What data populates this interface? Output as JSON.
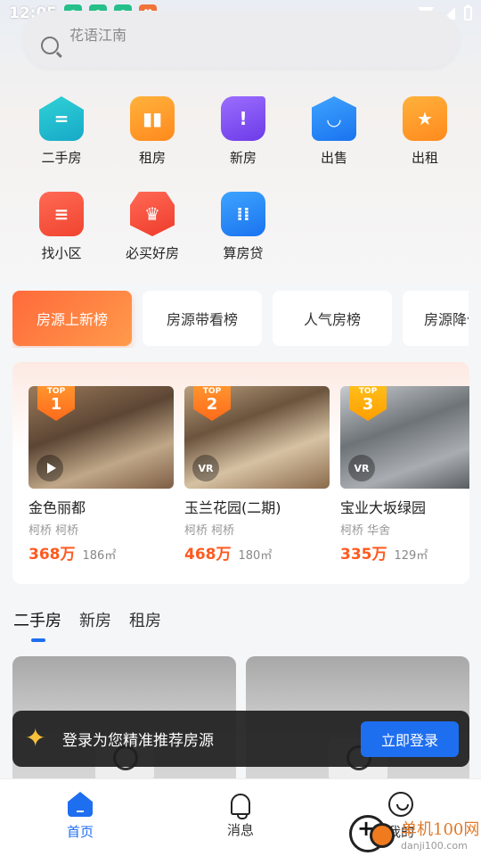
{
  "status_bar": {
    "time": "12:05"
  },
  "search": {
    "placeholder": "花语江南"
  },
  "quick_entries": [
    {
      "label": "二手房",
      "icon": "secondhand-house-icon"
    },
    {
      "label": "租房",
      "icon": "rent-house-icon"
    },
    {
      "label": "新房",
      "icon": "new-house-icon"
    },
    {
      "label": "出售",
      "icon": "sell-icon"
    },
    {
      "label": "出租",
      "icon": "lease-out-icon"
    },
    {
      "label": "找小区",
      "icon": "find-community-icon"
    },
    {
      "label": "必买好房",
      "icon": "must-buy-icon"
    },
    {
      "label": "算房贷",
      "icon": "mortgage-calculator-icon"
    }
  ],
  "rank_tabs": [
    "房源上新榜",
    "房源带看榜",
    "人气房榜",
    "房源降价"
  ],
  "rank_listings": [
    {
      "rank_label": "TOP",
      "rank": "1",
      "name": "金色丽都",
      "location": "柯桥 柯桥",
      "price": "368万",
      "area": "186㎡",
      "media": "play"
    },
    {
      "rank_label": "TOP",
      "rank": "2",
      "name": "玉兰花园(二期)",
      "location": "柯桥 柯桥",
      "price": "468万",
      "area": "180㎡",
      "media": "VR"
    },
    {
      "rank_label": "TOP",
      "rank": "3",
      "name": "宝业大坂绿园",
      "location": "柯桥 华舍",
      "price": "335万",
      "area": "129㎡",
      "media": "VR"
    }
  ],
  "category_tabs": [
    "二手房",
    "新房",
    "租房"
  ],
  "login_banner": {
    "text": "登录为您精准推荐房源",
    "button": "立即登录"
  },
  "bottom_nav": [
    {
      "label": "首页",
      "icon": "home-icon"
    },
    {
      "label": "消息",
      "icon": "bell-icon"
    },
    {
      "label": "我的",
      "icon": "profile-icon"
    }
  ],
  "watermark": {
    "name": "单机100网",
    "url": "danji100.com"
  },
  "colors": {
    "accent": "#1e6ef0",
    "price": "#ff5a1f",
    "active_tab": "#ff6a3b"
  }
}
